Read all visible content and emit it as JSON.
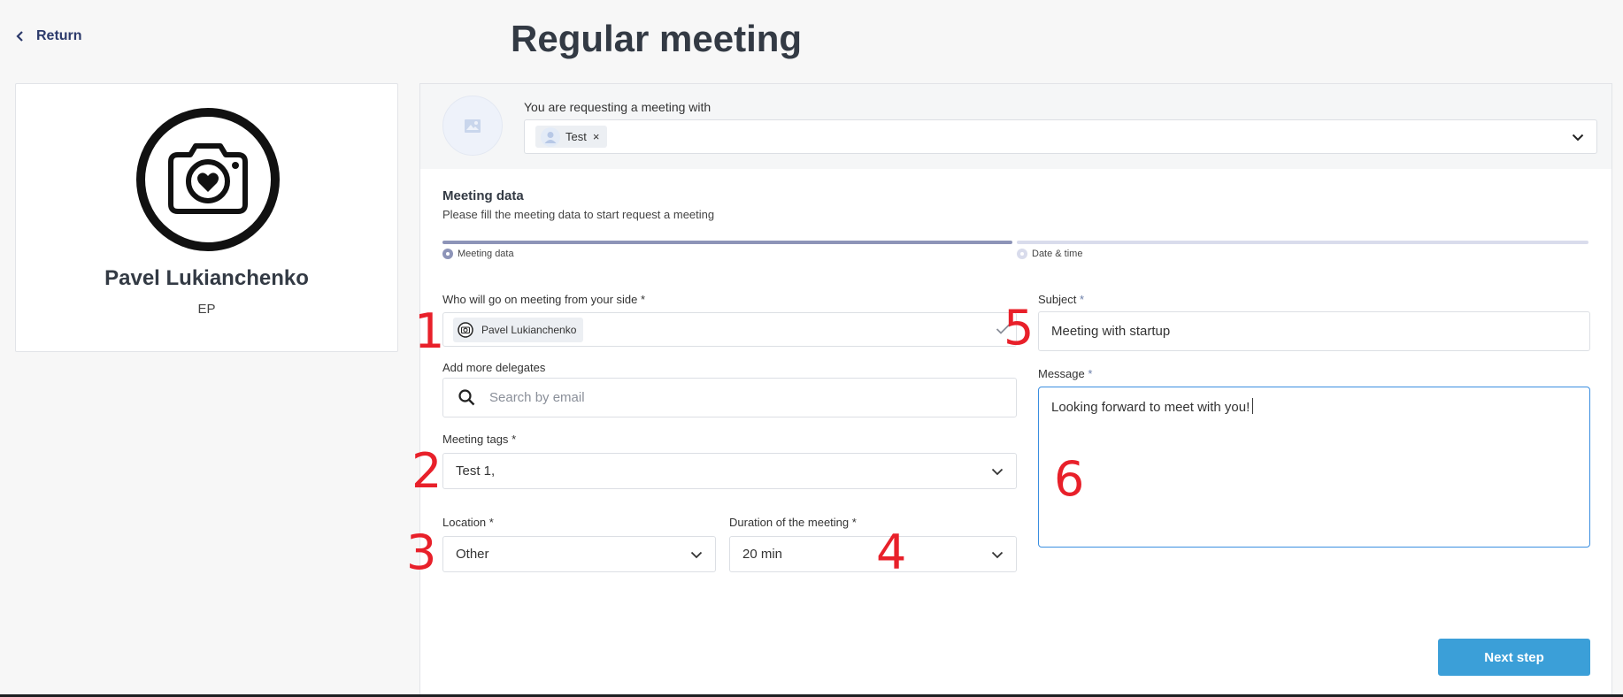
{
  "nav": {
    "return_label": "Return"
  },
  "page": {
    "title": "Regular meeting"
  },
  "profile": {
    "name": "Pavel Lukianchenko",
    "role": "EP"
  },
  "request": {
    "label": "You are requesting a meeting with",
    "selected_chip": "Test",
    "remove_symbol": "×"
  },
  "section": {
    "title": "Meeting data",
    "subtitle": "Please fill the meeting data to start request a meeting"
  },
  "steps": [
    {
      "label": "Meeting data",
      "active": true
    },
    {
      "label": "Date & time",
      "active": false
    }
  ],
  "form": {
    "who_label": "Who will go on meeting from your side",
    "who_value": "Pavel Lukianchenko",
    "delegates_label": "Add more delegates",
    "delegates_placeholder": "Search by email",
    "tags_label": "Meeting tags",
    "tags_value": "Test 1,",
    "location_label": "Location",
    "location_value": "Other",
    "duration_label": "Duration of the meeting",
    "duration_value": "20 min",
    "subject_label": "Subject",
    "subject_value": "Meeting with startup",
    "message_label": "Message",
    "message_value": "Looking forward to meet with you!",
    "required_mark": "*"
  },
  "actions": {
    "next_label": "Next step"
  },
  "annotations": [
    "1",
    "2",
    "3",
    "4",
    "5",
    "6"
  ],
  "colors": {
    "primary_button": "#3b9fd8",
    "step_active": "#8d94b8",
    "step_inactive": "#d9dcec",
    "annotation_red": "#e8202a",
    "focus_border": "#3a8ee0"
  }
}
